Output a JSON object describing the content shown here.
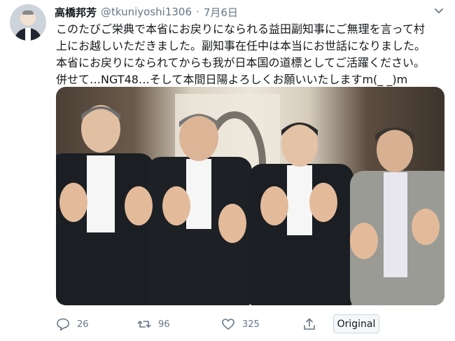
{
  "author": {
    "name": "高橋邦芳",
    "handle": "@tkuniyoshi1306",
    "separator": "·",
    "date": "7月6日"
  },
  "tweet_text": [
    "このたびご栄典で本省にお戻りになられる益田副知事にご無理を言って村",
    "上にお越しいただきました。副知事在任中は本当にお世話になりました。",
    "本省にお戻りになられてからも我が日本国の道標としてご活躍ください。",
    "併せて…NGT48…そして本間日陽よろしくお願いいたしますm(_ _)m"
  ],
  "actions": {
    "reply_count": "26",
    "retweet_count": "96",
    "like_count": "325",
    "original_button": "Original"
  },
  "icons": [
    "chevron-down-icon",
    "reply-icon",
    "retweet-icon",
    "like-icon",
    "share-icon"
  ],
  "colors": {
    "text": "#14171a",
    "secondary": "#657786",
    "border": "#ccd6dd"
  }
}
